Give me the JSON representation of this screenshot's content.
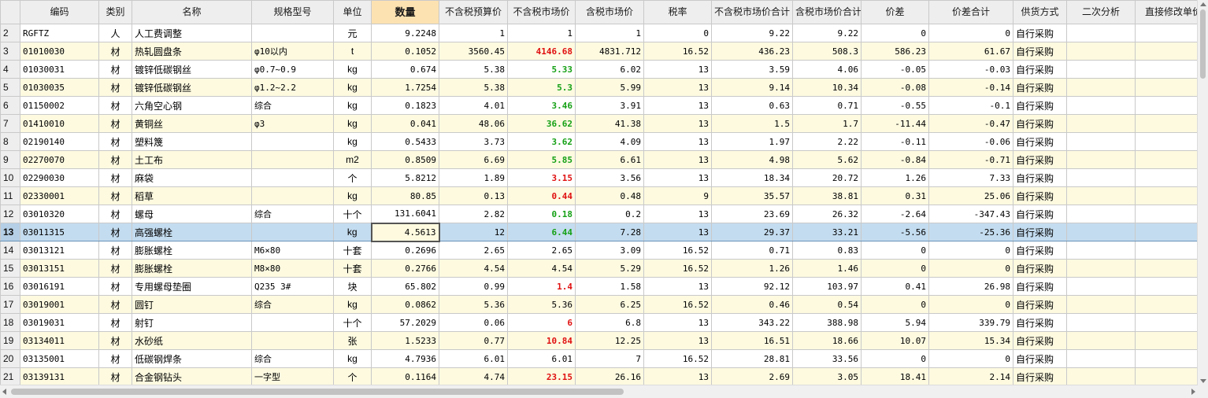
{
  "colors": {
    "alt_row": "#fdfae0",
    "selected_row": "#c4dcef",
    "header": "#eeeeee",
    "active_header": "#fde2b1",
    "red_mark": "#e01010",
    "green_mark": "#15a015"
  },
  "columns": [
    "",
    "编码",
    "类别",
    "名称",
    "规格型号",
    "单位",
    "数量",
    "不含税预算价",
    "不含税市场价",
    "含税市场价",
    "税率",
    "不含税市场价合计",
    "含税市场价合计",
    "价差",
    "价差合计",
    "供货方式",
    "二次分析",
    "直接修改单价"
  ],
  "active_column": "数量",
  "selected_row_index": "13",
  "rows": [
    {
      "idx": "2",
      "code": "RGFTZ",
      "cat": "人",
      "name": "人工费调整",
      "spec": "",
      "unit": "元",
      "qty": "9.2248",
      "pre": "1",
      "mkt": "1",
      "mkt_color": "none",
      "tax_price": "1",
      "rate": "0",
      "sum_pre": "9.22",
      "sum_tax": "9.22",
      "diff": "0",
      "diff_sum": "0",
      "supply": "自行采购",
      "ana": "",
      "edit": ""
    },
    {
      "idx": "3",
      "code": "01010030",
      "cat": "材",
      "name": "热轧圆盘条",
      "spec": "φ10以内",
      "unit": "t",
      "qty": "0.1052",
      "pre": "3560.45",
      "mkt": "4146.68",
      "mkt_color": "red",
      "tax_price": "4831.712",
      "rate": "16.52",
      "sum_pre": "436.23",
      "sum_tax": "508.3",
      "diff": "586.23",
      "diff_sum": "61.67",
      "supply": "自行采购",
      "ana": "",
      "edit": ""
    },
    {
      "idx": "4",
      "code": "01030031",
      "cat": "材",
      "name": "镀锌低碳钢丝",
      "spec": "φ0.7~0.9",
      "unit": "kg",
      "qty": "0.674",
      "pre": "5.38",
      "mkt": "5.33",
      "mkt_color": "green",
      "tax_price": "6.02",
      "rate": "13",
      "sum_pre": "3.59",
      "sum_tax": "4.06",
      "diff": "-0.05",
      "diff_sum": "-0.03",
      "supply": "自行采购",
      "ana": "",
      "edit": ""
    },
    {
      "idx": "5",
      "code": "01030035",
      "cat": "材",
      "name": "镀锌低碳钢丝",
      "spec": "φ1.2~2.2",
      "unit": "kg",
      "qty": "1.7254",
      "pre": "5.38",
      "mkt": "5.3",
      "mkt_color": "green",
      "tax_price": "5.99",
      "rate": "13",
      "sum_pre": "9.14",
      "sum_tax": "10.34",
      "diff": "-0.08",
      "diff_sum": "-0.14",
      "supply": "自行采购",
      "ana": "",
      "edit": ""
    },
    {
      "idx": "6",
      "code": "01150002",
      "cat": "材",
      "name": "六角空心钢",
      "spec": "综合",
      "unit": "kg",
      "qty": "0.1823",
      "pre": "4.01",
      "mkt": "3.46",
      "mkt_color": "green",
      "tax_price": "3.91",
      "rate": "13",
      "sum_pre": "0.63",
      "sum_tax": "0.71",
      "diff": "-0.55",
      "diff_sum": "-0.1",
      "supply": "自行采购",
      "ana": "",
      "edit": ""
    },
    {
      "idx": "7",
      "code": "01410010",
      "cat": "材",
      "name": "黄铜丝",
      "spec": "φ3",
      "unit": "kg",
      "qty": "0.041",
      "pre": "48.06",
      "mkt": "36.62",
      "mkt_color": "green",
      "tax_price": "41.38",
      "rate": "13",
      "sum_pre": "1.5",
      "sum_tax": "1.7",
      "diff": "-11.44",
      "diff_sum": "-0.47",
      "supply": "自行采购",
      "ana": "",
      "edit": ""
    },
    {
      "idx": "8",
      "code": "02190140",
      "cat": "材",
      "name": "塑料篾",
      "spec": "",
      "unit": "kg",
      "qty": "0.5433",
      "pre": "3.73",
      "mkt": "3.62",
      "mkt_color": "green",
      "tax_price": "4.09",
      "rate": "13",
      "sum_pre": "1.97",
      "sum_tax": "2.22",
      "diff": "-0.11",
      "diff_sum": "-0.06",
      "supply": "自行采购",
      "ana": "",
      "edit": ""
    },
    {
      "idx": "9",
      "code": "02270070",
      "cat": "材",
      "name": "土工布",
      "spec": "",
      "unit": "m2",
      "qty": "0.8509",
      "pre": "6.69",
      "mkt": "5.85",
      "mkt_color": "green",
      "tax_price": "6.61",
      "rate": "13",
      "sum_pre": "4.98",
      "sum_tax": "5.62",
      "diff": "-0.84",
      "diff_sum": "-0.71",
      "supply": "自行采购",
      "ana": "",
      "edit": ""
    },
    {
      "idx": "10",
      "code": "02290030",
      "cat": "材",
      "name": "麻袋",
      "spec": "",
      "unit": "个",
      "qty": "5.8212",
      "pre": "1.89",
      "mkt": "3.15",
      "mkt_color": "red",
      "tax_price": "3.56",
      "rate": "13",
      "sum_pre": "18.34",
      "sum_tax": "20.72",
      "diff": "1.26",
      "diff_sum": "7.33",
      "supply": "自行采购",
      "ana": "",
      "edit": ""
    },
    {
      "idx": "11",
      "code": "02330001",
      "cat": "材",
      "name": "稻草",
      "spec": "",
      "unit": "kg",
      "qty": "80.85",
      "pre": "0.13",
      "mkt": "0.44",
      "mkt_color": "red",
      "tax_price": "0.48",
      "rate": "9",
      "sum_pre": "35.57",
      "sum_tax": "38.81",
      "diff": "0.31",
      "diff_sum": "25.06",
      "supply": "自行采购",
      "ana": "",
      "edit": ""
    },
    {
      "idx": "12",
      "code": "03010320",
      "cat": "材",
      "name": "螺母",
      "spec": "综合",
      "unit": "十个",
      "qty": "131.6041",
      "pre": "2.82",
      "mkt": "0.18",
      "mkt_color": "green",
      "tax_price": "0.2",
      "rate": "13",
      "sum_pre": "23.69",
      "sum_tax": "26.32",
      "diff": "-2.64",
      "diff_sum": "-347.43",
      "supply": "自行采购",
      "ana": "",
      "edit": ""
    },
    {
      "idx": "13",
      "code": "03011315",
      "cat": "材",
      "name": "高强螺栓",
      "spec": "",
      "unit": "kg",
      "qty": "4.5613",
      "pre": "12",
      "mkt": "6.44",
      "mkt_color": "green",
      "tax_price": "7.28",
      "rate": "13",
      "sum_pre": "29.37",
      "sum_tax": "33.21",
      "diff": "-5.56",
      "diff_sum": "-25.36",
      "supply": "自行采购",
      "ana": "",
      "edit": ""
    },
    {
      "idx": "14",
      "code": "03013121",
      "cat": "材",
      "name": "膨胀螺栓",
      "spec": "M6×80",
      "unit": "十套",
      "qty": "0.2696",
      "pre": "2.65",
      "mkt": "2.65",
      "mkt_color": "none",
      "tax_price": "3.09",
      "rate": "16.52",
      "sum_pre": "0.71",
      "sum_tax": "0.83",
      "diff": "0",
      "diff_sum": "0",
      "supply": "自行采购",
      "ana": "",
      "edit": ""
    },
    {
      "idx": "15",
      "code": "03013151",
      "cat": "材",
      "name": "膨胀螺栓",
      "spec": "M8×80",
      "unit": "十套",
      "qty": "0.2766",
      "pre": "4.54",
      "mkt": "4.54",
      "mkt_color": "none",
      "tax_price": "5.29",
      "rate": "16.52",
      "sum_pre": "1.26",
      "sum_tax": "1.46",
      "diff": "0",
      "diff_sum": "0",
      "supply": "自行采购",
      "ana": "",
      "edit": ""
    },
    {
      "idx": "16",
      "code": "03016191",
      "cat": "材",
      "name": "专用螺母垫圈",
      "spec": "Q235 3#",
      "unit": "块",
      "qty": "65.802",
      "pre": "0.99",
      "mkt": "1.4",
      "mkt_color": "red",
      "tax_price": "1.58",
      "rate": "13",
      "sum_pre": "92.12",
      "sum_tax": "103.97",
      "diff": "0.41",
      "diff_sum": "26.98",
      "supply": "自行采购",
      "ana": "",
      "edit": ""
    },
    {
      "idx": "17",
      "code": "03019001",
      "cat": "材",
      "name": "圆钉",
      "spec": "综合",
      "unit": "kg",
      "qty": "0.0862",
      "pre": "5.36",
      "mkt": "5.36",
      "mkt_color": "none",
      "tax_price": "6.25",
      "rate": "16.52",
      "sum_pre": "0.46",
      "sum_tax": "0.54",
      "diff": "0",
      "diff_sum": "0",
      "supply": "自行采购",
      "ana": "",
      "edit": ""
    },
    {
      "idx": "18",
      "code": "03019031",
      "cat": "材",
      "name": "射钉",
      "spec": "",
      "unit": "十个",
      "qty": "57.2029",
      "pre": "0.06",
      "mkt": "6",
      "mkt_color": "red",
      "tax_price": "6.8",
      "rate": "13",
      "sum_pre": "343.22",
      "sum_tax": "388.98",
      "diff": "5.94",
      "diff_sum": "339.79",
      "supply": "自行采购",
      "ana": "",
      "edit": ""
    },
    {
      "idx": "19",
      "code": "03134011",
      "cat": "材",
      "name": "水砂纸",
      "spec": "",
      "unit": "张",
      "qty": "1.5233",
      "pre": "0.77",
      "mkt": "10.84",
      "mkt_color": "red",
      "tax_price": "12.25",
      "rate": "13",
      "sum_pre": "16.51",
      "sum_tax": "18.66",
      "diff": "10.07",
      "diff_sum": "15.34",
      "supply": "自行采购",
      "ana": "",
      "edit": ""
    },
    {
      "idx": "20",
      "code": "03135001",
      "cat": "材",
      "name": "低碳钢焊条",
      "spec": "综合",
      "unit": "kg",
      "qty": "4.7936",
      "pre": "6.01",
      "mkt": "6.01",
      "mkt_color": "none",
      "tax_price": "7",
      "rate": "16.52",
      "sum_pre": "28.81",
      "sum_tax": "33.56",
      "diff": "0",
      "diff_sum": "0",
      "supply": "自行采购",
      "ana": "",
      "edit": ""
    },
    {
      "idx": "21",
      "code": "03139131",
      "cat": "材",
      "name": "合金钢钻头",
      "spec": "一字型",
      "unit": "个",
      "qty": "0.1164",
      "pre": "4.74",
      "mkt": "23.15",
      "mkt_color": "red",
      "tax_price": "26.16",
      "rate": "13",
      "sum_pre": "2.69",
      "sum_tax": "3.05",
      "diff": "18.41",
      "diff_sum": "2.14",
      "supply": "自行采购",
      "ana": "",
      "edit": ""
    }
  ]
}
